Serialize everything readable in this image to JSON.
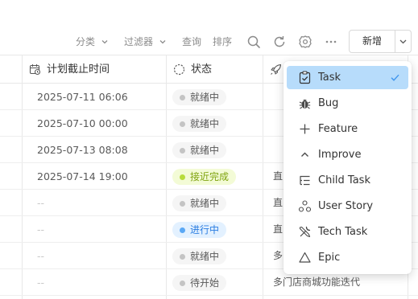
{
  "toolbar": {
    "group_label": "分类",
    "filter_label": "过滤器",
    "query_label": "查询",
    "sort_label": "排序",
    "icons": [
      "search-icon",
      "refresh-icon",
      "settings-icon",
      "more-icon"
    ],
    "new_button_label": "新增"
  },
  "table": {
    "columns": [
      {
        "label": "计划截止时间",
        "icon": "calendar-clock-icon"
      },
      {
        "label": "状态",
        "icon": "status-circle-icon"
      },
      {
        "label": "",
        "icon": "rocket-icon"
      }
    ],
    "rows": [
      {
        "date": "2025-07-11 06:06",
        "status": "就绪中",
        "status_kind": "ready",
        "project": ""
      },
      {
        "date": "2025-07-10 00:00",
        "status": "就绪中",
        "status_kind": "ready",
        "project": ""
      },
      {
        "date": "2025-07-13 08:08",
        "status": "就绪中",
        "status_kind": "ready",
        "project": ""
      },
      {
        "date": "2025-07-14 19:00",
        "status": "接近完成",
        "status_kind": "near",
        "project": "直"
      },
      {
        "date": "--",
        "status": "就绪中",
        "status_kind": "ready",
        "project": "直"
      },
      {
        "date": "--",
        "status": "进行中",
        "status_kind": "progress",
        "project": "直"
      },
      {
        "date": "--",
        "status": "就绪中",
        "status_kind": "ready",
        "project": "多"
      },
      {
        "date": "--",
        "status": "待开始",
        "status_kind": "ready",
        "project": "多门店商城功能迭代"
      }
    ],
    "status_colors": {
      "ready": {
        "bg": "#f5f5f5",
        "fg": "#595959",
        "dot": "#c4c4c4"
      },
      "near": {
        "bg": "#f3fbd6",
        "fg": "#7fa30f",
        "dot": "#b8dc3c"
      },
      "progress": {
        "bg": "#e3f1ff",
        "fg": "#2a7de1",
        "dot": "#5aa8f5"
      }
    }
  },
  "type_menu": {
    "selected_bg": "#b7dcfb",
    "items": [
      {
        "label": "Task",
        "icon": "task-clipboard-icon",
        "selected": true
      },
      {
        "label": "Bug",
        "icon": "bug-icon",
        "selected": false
      },
      {
        "label": "Feature",
        "icon": "plus-icon",
        "selected": false
      },
      {
        "label": "Improve",
        "icon": "chevron-up-icon",
        "selected": false
      },
      {
        "label": "Child Task",
        "icon": "child-task-icon",
        "selected": false
      },
      {
        "label": "User Story",
        "icon": "user-story-icon",
        "selected": false
      },
      {
        "label": "Tech Task",
        "icon": "tech-task-tools-icon",
        "selected": false
      },
      {
        "label": "Epic",
        "icon": "epic-triangle-icon",
        "selected": false
      }
    ]
  }
}
